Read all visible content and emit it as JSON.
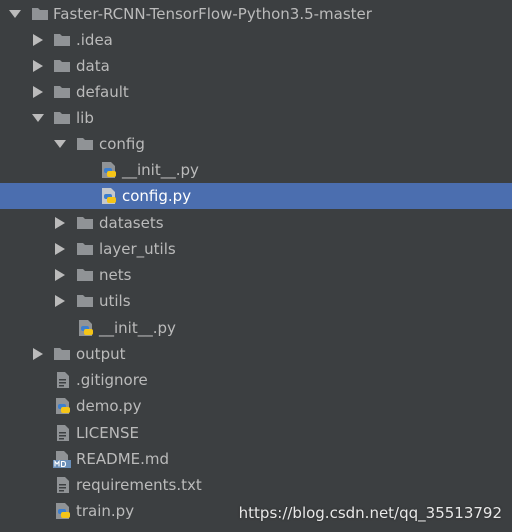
{
  "project_tree": {
    "items": [
      {
        "label": "Faster-RCNN-TensorFlow-Python3.5-master",
        "kind": "folder",
        "expanded": true
      },
      {
        "label": ".idea",
        "kind": "folder",
        "expanded": false
      },
      {
        "label": "data",
        "kind": "folder",
        "expanded": false
      },
      {
        "label": "default",
        "kind": "folder",
        "expanded": false
      },
      {
        "label": "lib",
        "kind": "folder",
        "expanded": true
      },
      {
        "label": "config",
        "kind": "folder",
        "expanded": true
      },
      {
        "label": "__init__.py",
        "kind": "python-file"
      },
      {
        "label": "config.py",
        "kind": "python-file",
        "selected": true
      },
      {
        "label": "datasets",
        "kind": "folder",
        "expanded": false
      },
      {
        "label": "layer_utils",
        "kind": "folder",
        "expanded": false
      },
      {
        "label": "nets",
        "kind": "folder",
        "expanded": false
      },
      {
        "label": "utils",
        "kind": "folder",
        "expanded": false
      },
      {
        "label": "__init__.py",
        "kind": "python-file"
      },
      {
        "label": "output",
        "kind": "folder",
        "expanded": false
      },
      {
        "label": ".gitignore",
        "kind": "text-file"
      },
      {
        "label": "demo.py",
        "kind": "python-file"
      },
      {
        "label": "LICENSE",
        "kind": "text-file"
      },
      {
        "label": "README.md",
        "kind": "markdown-file"
      },
      {
        "label": "requirements.txt",
        "kind": "text-file"
      },
      {
        "label": "train.py",
        "kind": "python-file"
      }
    ]
  },
  "watermark": "https://blog.csdn.net/qq_35513792",
  "colors": {
    "background": "#3c3f41",
    "selection": "#4b6eaf",
    "text": "#bbbbbb",
    "folder": "#909396",
    "python_blue": "#3d7fcf",
    "python_yellow": "#f5c518"
  },
  "icons": {
    "folder": "folder-icon",
    "python-file": "python-file-icon",
    "text-file": "text-file-icon",
    "markdown-file": "markdown-file-icon",
    "expanded": "chevron-down-icon",
    "collapsed": "chevron-right-icon"
  }
}
